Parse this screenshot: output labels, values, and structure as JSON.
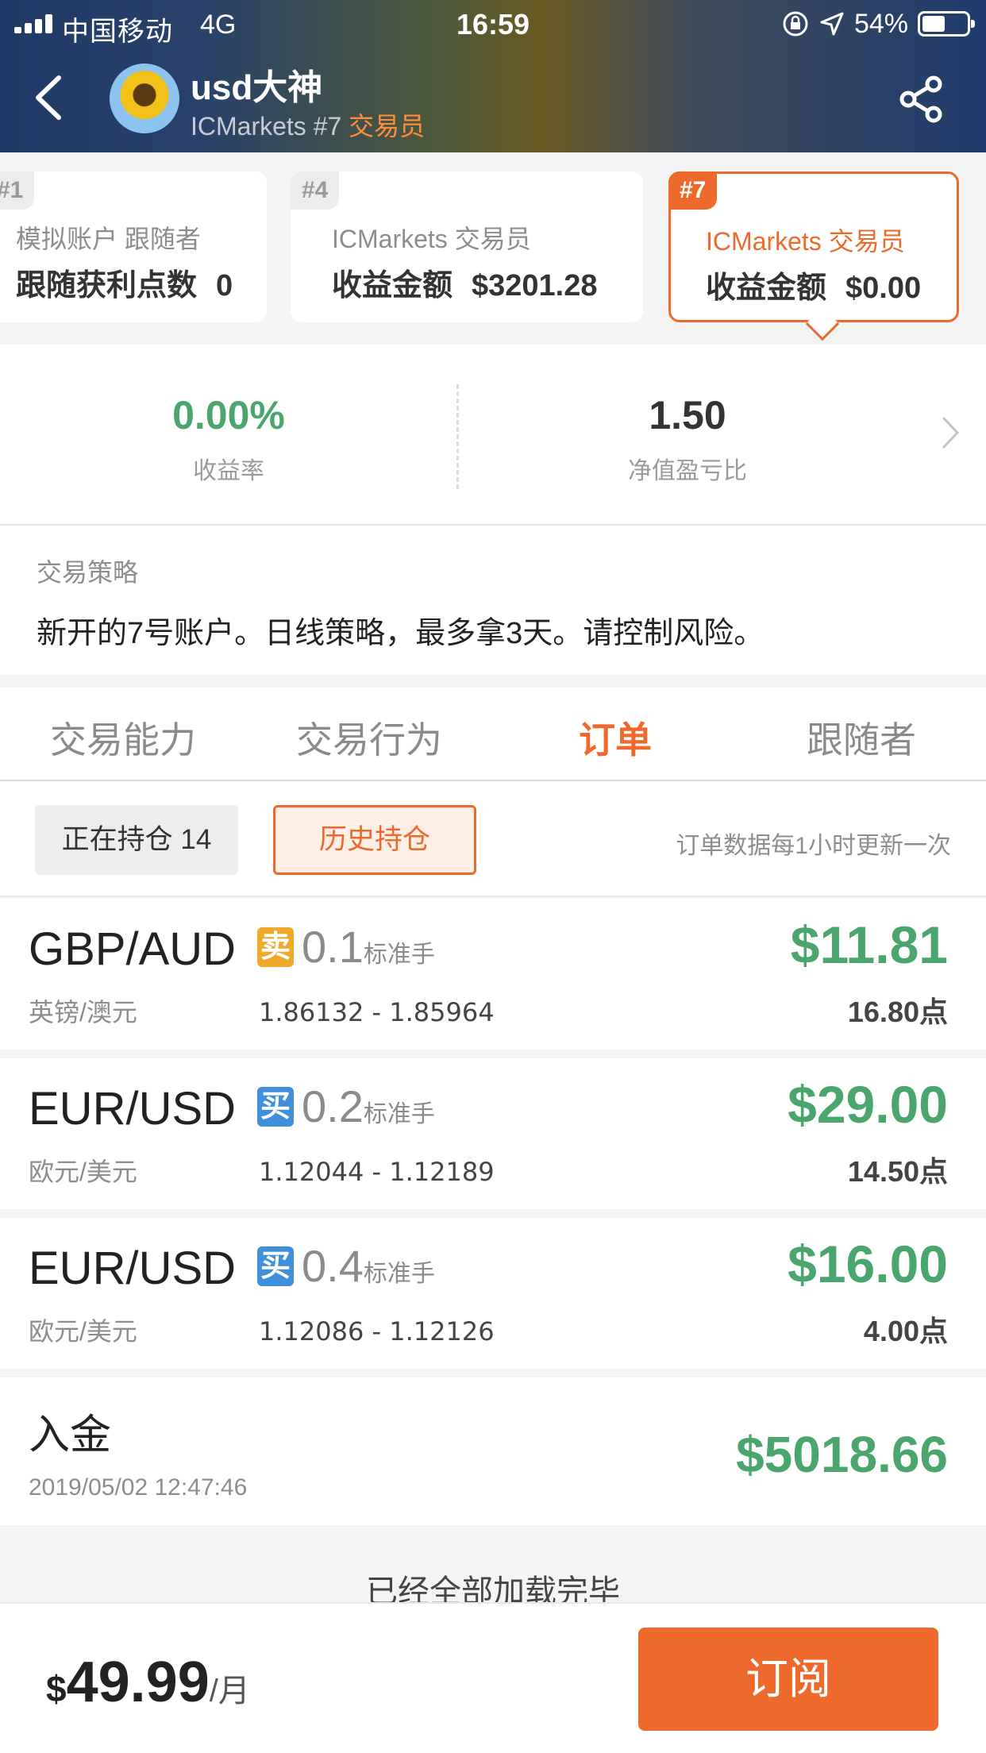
{
  "status_bar": {
    "carrier": "中国移动",
    "network": "4G",
    "time": "16:59",
    "battery": "54%"
  },
  "header": {
    "username": "usd大神",
    "broker": "ICMarkets #7",
    "role": "交易员"
  },
  "accounts": [
    {
      "tag": "#1",
      "line1": "模拟账户  跟随者",
      "label": "跟随获利点数",
      "value": "0"
    },
    {
      "tag": "#4",
      "line1": "ICMarkets  交易员",
      "label": "收益金额",
      "value": "$3201.28"
    },
    {
      "tag": "#7",
      "line1": "ICMarkets  交易员",
      "label": "收益金额",
      "value": "$0.00"
    }
  ],
  "stats": {
    "return_value": "0.00%",
    "return_label": "收益率",
    "equity_value": "1.50",
    "equity_label": "净值盈亏比"
  },
  "strategy": {
    "title": "交易策略",
    "text": "新开的7号账户。日线策略，最多拿3天。请控制风险。"
  },
  "tabs": [
    "交易能力",
    "交易行为",
    "订单",
    "跟随者"
  ],
  "filter": {
    "open_label": "正在持仓 14",
    "history_label": "历史持仓",
    "note": "订单数据每1小时更新一次"
  },
  "orders": [
    {
      "pair": "GBP/AUD",
      "cn": "英镑/澳元",
      "side": "卖",
      "lots": "0.1",
      "unit": "标准手",
      "price": "1.86132 - 1.85964",
      "pnl": "$11.81",
      "points": "16.80点"
    },
    {
      "pair": "EUR/USD",
      "cn": "欧元/美元",
      "side": "买",
      "lots": "0.2",
      "unit": "标准手",
      "price": "1.12044 - 1.12189",
      "pnl": "$29.00",
      "points": "14.50点"
    },
    {
      "pair": "EUR/USD",
      "cn": "欧元/美元",
      "side": "买",
      "lots": "0.4",
      "unit": "标准手",
      "price": "1.12086 - 1.12126",
      "pnl": "$16.00",
      "points": "4.00点"
    }
  ],
  "deposit": {
    "label": "入金",
    "datetime": "2019/05/02 12:47:46",
    "amount": "$5018.66"
  },
  "loaded_text": "已经全部加载完毕",
  "footer": {
    "currency": "$",
    "price": "49.99",
    "period": "/月",
    "subscribe_label": "订阅"
  },
  "colors": {
    "accent": "#ee6a2c",
    "profit": "#4aa56e",
    "sell": "#efa92c",
    "buy": "#3f8fda"
  }
}
